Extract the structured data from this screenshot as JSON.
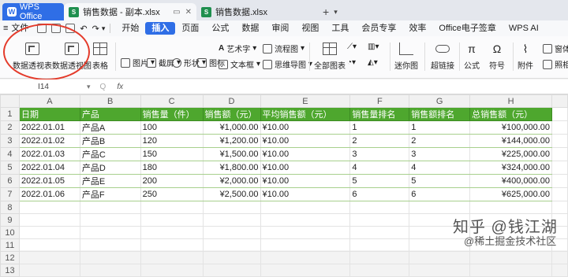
{
  "titlebar": {
    "app_tab": "WPS Office",
    "doc_tabs": [
      {
        "label": "销售数据 - 副本.xlsx"
      },
      {
        "label": "销售数据.xlsx"
      }
    ]
  },
  "menu": {
    "file": "文件",
    "items": [
      "开始",
      "插入",
      "页面",
      "公式",
      "数据",
      "审阅",
      "视图",
      "工具",
      "会员专享",
      "效率",
      "Office电子签章",
      "WPS AI"
    ]
  },
  "ribbon": {
    "pivot_table": "数据透视表",
    "pivot_chart": "数据透视图",
    "table": "表格",
    "picture": "图片",
    "screenshot": "截屏",
    "shapes": "形状",
    "icons": "图标",
    "wordart": "艺术字",
    "textbox": "文本框",
    "flowchart": "流程图",
    "mindmap": "思维导图",
    "all_charts": "全部图表",
    "sparkline": "迷你图",
    "hyperlink": "超链接",
    "formula": "公式",
    "symbol": "符号",
    "attachment": "附件",
    "form": "窗体",
    "camera": "照相机"
  },
  "formula_bar": {
    "name_box": "I14",
    "fx": "fx",
    "zoom_icon": "Q"
  },
  "sheet": {
    "columns": [
      "A",
      "B",
      "C",
      "D",
      "E",
      "F",
      "G",
      "H"
    ],
    "header": [
      "日期",
      "产品",
      "销售量（件）",
      "销售额（元）",
      "平均销售额（元）",
      "销售量排名",
      "销售额排名",
      "总销售额（元）"
    ],
    "rows": [
      [
        "2022.01.01",
        "产品A",
        "100",
        "¥1,000.00",
        "¥10.00",
        "1",
        "1",
        "¥100,000.00"
      ],
      [
        "2022.01.02",
        "产品B",
        "120",
        "¥1,200.00",
        "¥10.00",
        "2",
        "2",
        "¥144,000.00"
      ],
      [
        "2022.01.03",
        "产品C",
        "150",
        "¥1,500.00",
        "¥10.00",
        "3",
        "3",
        "¥225,000.00"
      ],
      [
        "2022.01.04",
        "产品D",
        "180",
        "¥1,800.00",
        "¥10.00",
        "4",
        "4",
        "¥324,000.00"
      ],
      [
        "2022.01.05",
        "产品E",
        "200",
        "¥2,000.00",
        "¥10.00",
        "5",
        "5",
        "¥400,000.00"
      ],
      [
        "2022.01.06",
        "产品F",
        "250",
        "¥2,500.00",
        "¥10.00",
        "6",
        "6",
        "¥625,000.00"
      ]
    ],
    "row_numbers": [
      "1",
      "2",
      "3",
      "4",
      "5",
      "6",
      "7",
      "8",
      "9",
      "10",
      "11",
      "12",
      "13"
    ]
  },
  "watermark": {
    "line1": "知乎 @钱江湖",
    "line2": "@稀土掘金技术社区"
  }
}
